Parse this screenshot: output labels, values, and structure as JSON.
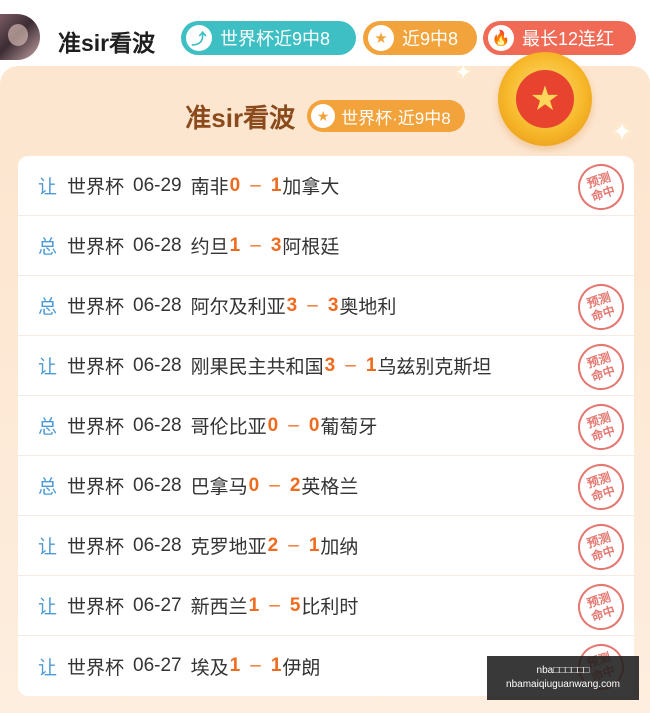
{
  "header": {
    "username": "准sir看波",
    "badges": [
      {
        "icon": "arrow-up-icon",
        "glyph": "⤴",
        "label": "世界杯近9中8",
        "color": "#3dbfc4"
      },
      {
        "icon": "star-icon",
        "glyph": "★",
        "label": "近9中8",
        "color": "#f2a33c"
      },
      {
        "icon": "fire-icon",
        "glyph": "🔥",
        "label": "最长12连红",
        "color": "#f06a55"
      }
    ]
  },
  "card": {
    "title": "准sir看波",
    "badge_glyph": "★",
    "badge": "世界杯·近9中8",
    "medal_glyph": "★"
  },
  "predictions": [
    {
      "tag": "让",
      "league": "世界杯",
      "date": "06-29",
      "home": "南非",
      "home_score": "0",
      "away_score": "1",
      "away": "加拿大",
      "hit": true
    },
    {
      "tag": "总",
      "league": "世界杯",
      "date": "06-28",
      "home": "约旦",
      "home_score": "1",
      "away_score": "3",
      "away": "阿根廷",
      "hit": false
    },
    {
      "tag": "总",
      "league": "世界杯",
      "date": "06-28",
      "home": "阿尔及利亚",
      "home_score": "3",
      "away_score": "3",
      "away": "奥地利",
      "hit": true
    },
    {
      "tag": "让",
      "league": "世界杯",
      "date": "06-28",
      "home": "刚果民主共和国",
      "home_score": "3",
      "away_score": "1",
      "away": "乌兹别克斯坦",
      "hit": true
    },
    {
      "tag": "总",
      "league": "世界杯",
      "date": "06-28",
      "home": "哥伦比亚",
      "home_score": "0",
      "away_score": "0",
      "away": "葡萄牙",
      "hit": true
    },
    {
      "tag": "总",
      "league": "世界杯",
      "date": "06-28",
      "home": "巴拿马",
      "home_score": "0",
      "away_score": "2",
      "away": "英格兰",
      "hit": true
    },
    {
      "tag": "让",
      "league": "世界杯",
      "date": "06-28",
      "home": "克罗地亚",
      "home_score": "2",
      "away_score": "1",
      "away": "加纳",
      "hit": true
    },
    {
      "tag": "让",
      "league": "世界杯",
      "date": "06-27",
      "home": "新西兰",
      "home_score": "1",
      "away_score": "5",
      "away": "比利时",
      "hit": true
    },
    {
      "tag": "让",
      "league": "世界杯",
      "date": "06-27",
      "home": "埃及",
      "home_score": "1",
      "away_score": "1",
      "away": "伊朗",
      "hit": true
    }
  ],
  "score_separator": "–",
  "stamp_text": {
    "line1": "预测",
    "line2": "命中"
  },
  "watermark": {
    "line1": "nba□□□□□□",
    "line2": "nbamaiqiuguanwang.com"
  }
}
